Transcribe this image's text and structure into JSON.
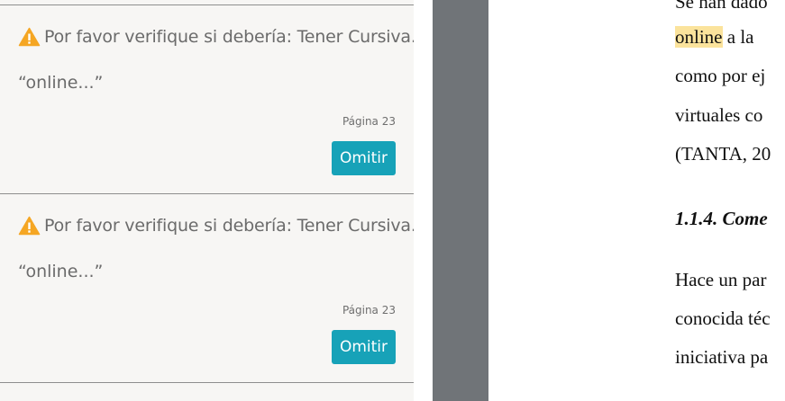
{
  "issues": [
    {
      "message": "Por favor verifique si debería: Tener Cursiva.",
      "snippet": "“online...”",
      "page": "Página 23",
      "action_label": "Omitir"
    },
    {
      "message": "Por favor verifique si debería: Tener Cursiva.",
      "snippet": "“online...”",
      "page": "Página 23",
      "action_label": "Omitir"
    }
  ],
  "icons": {
    "warning": "warning-icon",
    "warning_color": "#f5a623"
  },
  "colors": {
    "button": "#17a2b8",
    "highlight": "#fbe39c",
    "viewer_background": "#707478"
  },
  "document": {
    "lines": [
      "Se han dado",
      "a la",
      "como por ej",
      "virtuales co",
      "(TANTA, 20",
      "1.1.4. Come",
      "Hace un par",
      "conocida téc",
      "iniciativa pa"
    ],
    "highlighted_word": "online"
  }
}
